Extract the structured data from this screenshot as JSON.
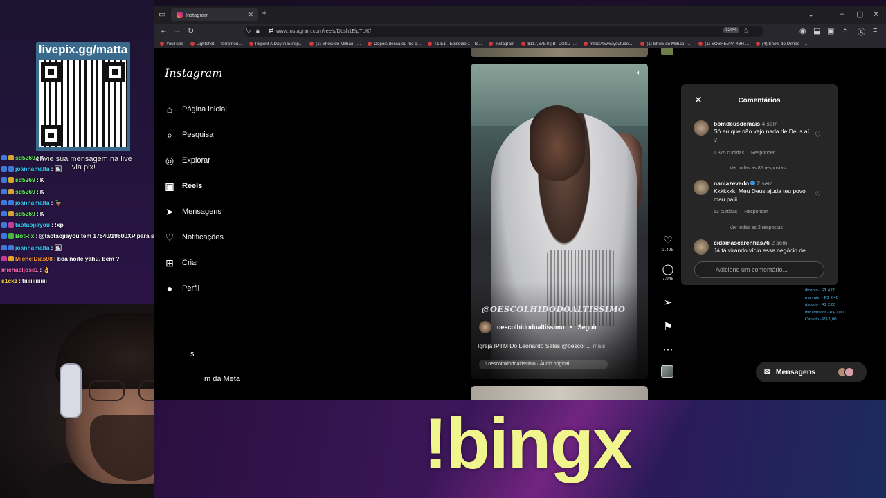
{
  "stream": {
    "pix_title": "livepix.gg/matta",
    "pix_caption": "envie sua mensagem na live via pix!",
    "chat": [
      {
        "user": "sd5269",
        "msg": "K",
        "color": "u-green",
        "badges": [
          "b-blue",
          "b-gold"
        ]
      },
      {
        "user": "joannamalta",
        "msg": "🖼",
        "color": "u-cyan",
        "badges": [
          "b-blue",
          "b-blue"
        ]
      },
      {
        "user": "sd5269",
        "msg": "K",
        "color": "u-green",
        "badges": [
          "b-blue",
          "b-gold"
        ]
      },
      {
        "user": "sd5269",
        "msg": "K",
        "color": "u-green",
        "badges": [
          "b-blue",
          "b-gold"
        ]
      },
      {
        "user": "joannamalta",
        "msg": "🦆",
        "color": "u-cyan",
        "badges": [
          "b-blue",
          "b-blue"
        ]
      },
      {
        "user": "sd5269",
        "msg": "K",
        "color": "u-green",
        "badges": [
          "b-blue",
          "b-gold"
        ]
      },
      {
        "user": "taotaojiayou",
        "msg": "!xp",
        "color": "u-cyan",
        "badges": [
          "b-blue",
          "b-pink"
        ]
      },
      {
        "user": "BotRix",
        "msg": "@taotaojiayou tem 17540/19600XP para subir de nível",
        "color": "u-green",
        "badges": [
          "b-blue",
          "b-green"
        ]
      },
      {
        "user": "joannamalta",
        "msg": "🖼",
        "color": "u-cyan",
        "badges": [
          "b-blue",
          "b-blue"
        ]
      },
      {
        "user": "MichelDias98",
        "msg": "boa noite yahu, bem ?",
        "color": "u-orange",
        "badges": [
          "b-pink",
          "b-gold"
        ]
      },
      {
        "user": "michaeljose1",
        "msg": "👌",
        "color": "u-pink",
        "badges": []
      },
      {
        "user": "s1ckz",
        "msg": "tiiiiiiiiiiiiii",
        "color": "u-yellow",
        "badges": []
      }
    ],
    "banner_text": "!bingx"
  },
  "browser": {
    "tab_title": "Instagram",
    "url": "www.instagram.com/reels/DLsh1ElpTUK/",
    "zoom": "120%",
    "bookmarks": [
      "YouTube",
      "Lightshot — ferramen...",
      "I Spent A Day in Europ...",
      "(1) Show do Milhão - ...",
      "Depois dessa eu me a...",
      "T1:E1 - Episódio 1 - Te...",
      "Instagram",
      "$117,678.0 | BTCUSDT...",
      "https://www.youtube....",
      "(1) Show do Milhão - ...",
      "(1) SOBREVIVI 48H ...",
      "(4) Show do Milhão - ..."
    ]
  },
  "instagram": {
    "logo": "Instagram",
    "nav": [
      {
        "label": "Página inicial",
        "icon": "home-icon",
        "glyph": "⌂",
        "bold": false
      },
      {
        "label": "Pesquisa",
        "icon": "search-icon",
        "glyph": "⌕",
        "bold": false
      },
      {
        "label": "Explorar",
        "icon": "compass-icon",
        "glyph": "◎",
        "bold": false
      },
      {
        "label": "Reels",
        "icon": "reels-icon",
        "glyph": "▣",
        "bold": true
      },
      {
        "label": "Mensagens",
        "icon": "send-icon",
        "glyph": "➤",
        "bold": false
      },
      {
        "label": "Notificações",
        "icon": "heart-icon",
        "glyph": "♡",
        "bold": false
      },
      {
        "label": "Criar",
        "icon": "plus-icon",
        "glyph": "⊞",
        "bold": false
      },
      {
        "label": "Perfil",
        "icon": "avatar-icon",
        "glyph": "●",
        "bold": false
      }
    ],
    "nav_extra": [
      "s",
      "m da Meta"
    ],
    "reel": {
      "watermark": "@OESCOLHIDODOALTISSIMO",
      "username": "oescolhidodoaltissimo",
      "follow": "Seguir",
      "caption": "Igreja IPTM Do Leonardo Sales @oescol ...",
      "more": "mais",
      "audio": "♫ oescolhidodoaltissimo · Áudio original"
    },
    "actions": {
      "likes": "3.498",
      "comments": "7.948"
    },
    "comments_panel": {
      "title": "Comentários",
      "items": [
        {
          "user": "bomdeusdemais",
          "time": "4 sem",
          "text": "Só eu que não vejo nada de Deus aí ?",
          "likes": "1.375 curtidas",
          "reply": "Responder",
          "view": "Ver todas as 85 respostas",
          "verified": false
        },
        {
          "user": "naniazevedo",
          "time": "2 sem",
          "text": "Kkkkkkk. Meu Deus ajuda teu povo mau paiii",
          "likes": "53 curtidas",
          "reply": "Responder",
          "view": "Ver todas as 2 respostas",
          "verified": true
        },
        {
          "user": "cidamascarenhas76",
          "time": "2 sem",
          "text": "Já tá virando vício esse negócio de"
        }
      ],
      "input_placeholder": "Adicione um comentário..."
    },
    "donations": [
      "diozoto - R$ 4,00",
      "marvaier - R$ 2,40",
      "riscado - R$ 2,00",
      "miriamfacor - R$ 1,00",
      "Carvolo - R$ 1,00"
    ],
    "messages_label": "Mensagens"
  }
}
